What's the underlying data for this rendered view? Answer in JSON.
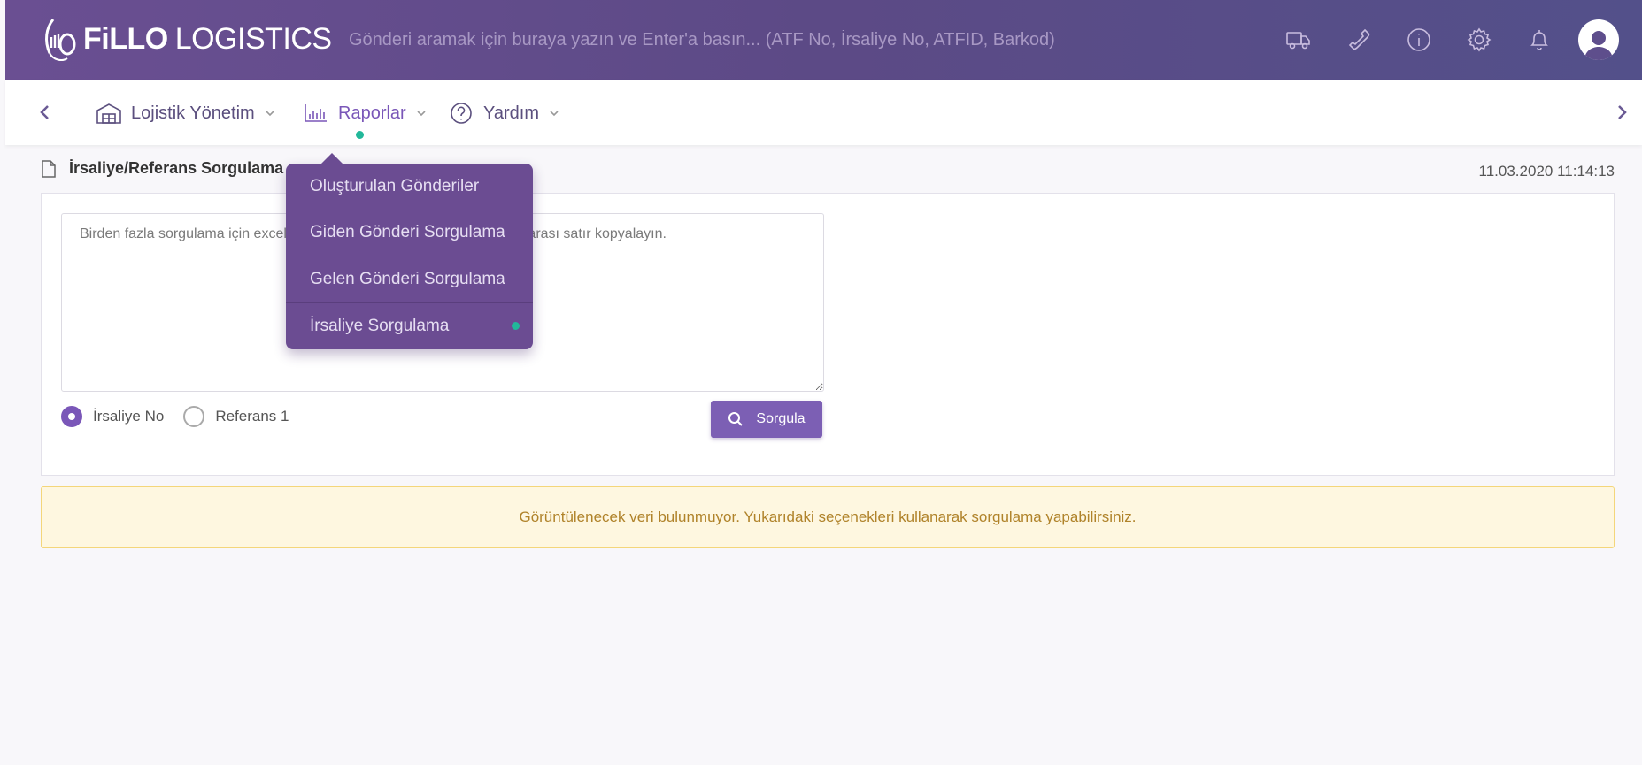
{
  "header": {
    "brand_bold": "FiLLO",
    "brand_light": "LOGISTICS",
    "search_placeholder": "Gönderi aramak için buraya yazın ve Enter'a basın... (ATF No, İrsaliye No, ATFID, Barkod)",
    "icons": [
      "truck-icon",
      "phone-icon",
      "info-icon",
      "gear-icon",
      "bell-icon",
      "user-avatar"
    ]
  },
  "nav": {
    "items": [
      {
        "label": "Lojistik Yönetim",
        "icon": "warehouse-icon"
      },
      {
        "label": "Raporlar",
        "icon": "bar-chart-icon",
        "active": true
      },
      {
        "label": "Yardım",
        "icon": "help-icon"
      }
    ]
  },
  "dropdown": {
    "items": [
      {
        "label": "Oluşturulan Gönderiler"
      },
      {
        "label": "Giden Gönderi Sorgulama"
      },
      {
        "label": "Gelen Gönderi Sorgulama"
      },
      {
        "label": "İrsaliye Sorgulama",
        "active": true
      }
    ]
  },
  "page": {
    "title": "İrsaliye/Referans Sorgulama",
    "datetime": "11.03.2020 11:14:13"
  },
  "form": {
    "textarea_placeholder": "Birden fazla sorgulama için excel'den alt alta irsaliye veya referans numarası satır kopyalayın.",
    "radio_1": "İrsaliye No",
    "radio_2": "Referans 1",
    "selected": "İrsaliye No",
    "submit_label": "Sorgula"
  },
  "alert": {
    "message": "Görüntülenecek veri bulunmuyor. Yukarıdaki seçenekleri kullanarak sorgulama yapabilirsiniz."
  },
  "colors": {
    "header_bg": "#5e4e8c",
    "accent": "#7c5fb4",
    "active_dot": "#22b89a",
    "alert_bg": "#fef7e0"
  }
}
